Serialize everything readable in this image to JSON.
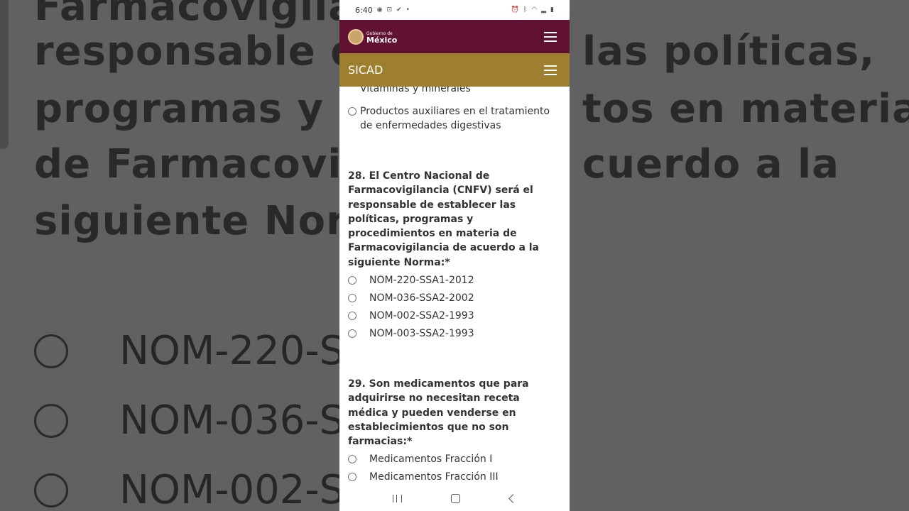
{
  "background": {
    "lines": [
      "Farmacovigilar",
      "responsable de",
      "las políticas,",
      "programas y pr",
      "tos en materia",
      "de Farmacovig",
      "cuerdo a la",
      "siguiente Norm"
    ],
    "options": [
      "NOM-220-S",
      "NOM-036-S",
      "NOM-002-S"
    ]
  },
  "status_bar": {
    "time": "6:40"
  },
  "gov_header": {
    "logo_small": "Gobierno de",
    "logo_big": "México"
  },
  "app_header": {
    "title": "SICAD"
  },
  "prev_question": {
    "options": [
      "Vitaminas y minerales",
      "Productos auxiliares en el tratamiento de enfermedades digestivas"
    ]
  },
  "q28": {
    "text": "28. El Centro Nacional de Farmacovigilancia (CNFV) será el responsable de establecer las políticas, programas y procedimientos en materia de Farmacovigilancia de acuerdo a la siguiente Norma:*",
    "options": [
      "NOM-220-SSA1-2012",
      "NOM-036-SSA2-2002",
      "NOM-002-SSA2-1993",
      "NOM-003-SSA2-1993"
    ]
  },
  "q29": {
    "text": "29. Son medicamentos que para adquirirse no necesitan receta médica y pueden venderse en establecimientos que no son farmacias:*",
    "options": [
      "Medicamentos Fracción I",
      "Medicamentos Fracción III"
    ]
  },
  "colors": {
    "gov_maroon": "#611232",
    "sicad_gold": "#9d7f2f"
  }
}
